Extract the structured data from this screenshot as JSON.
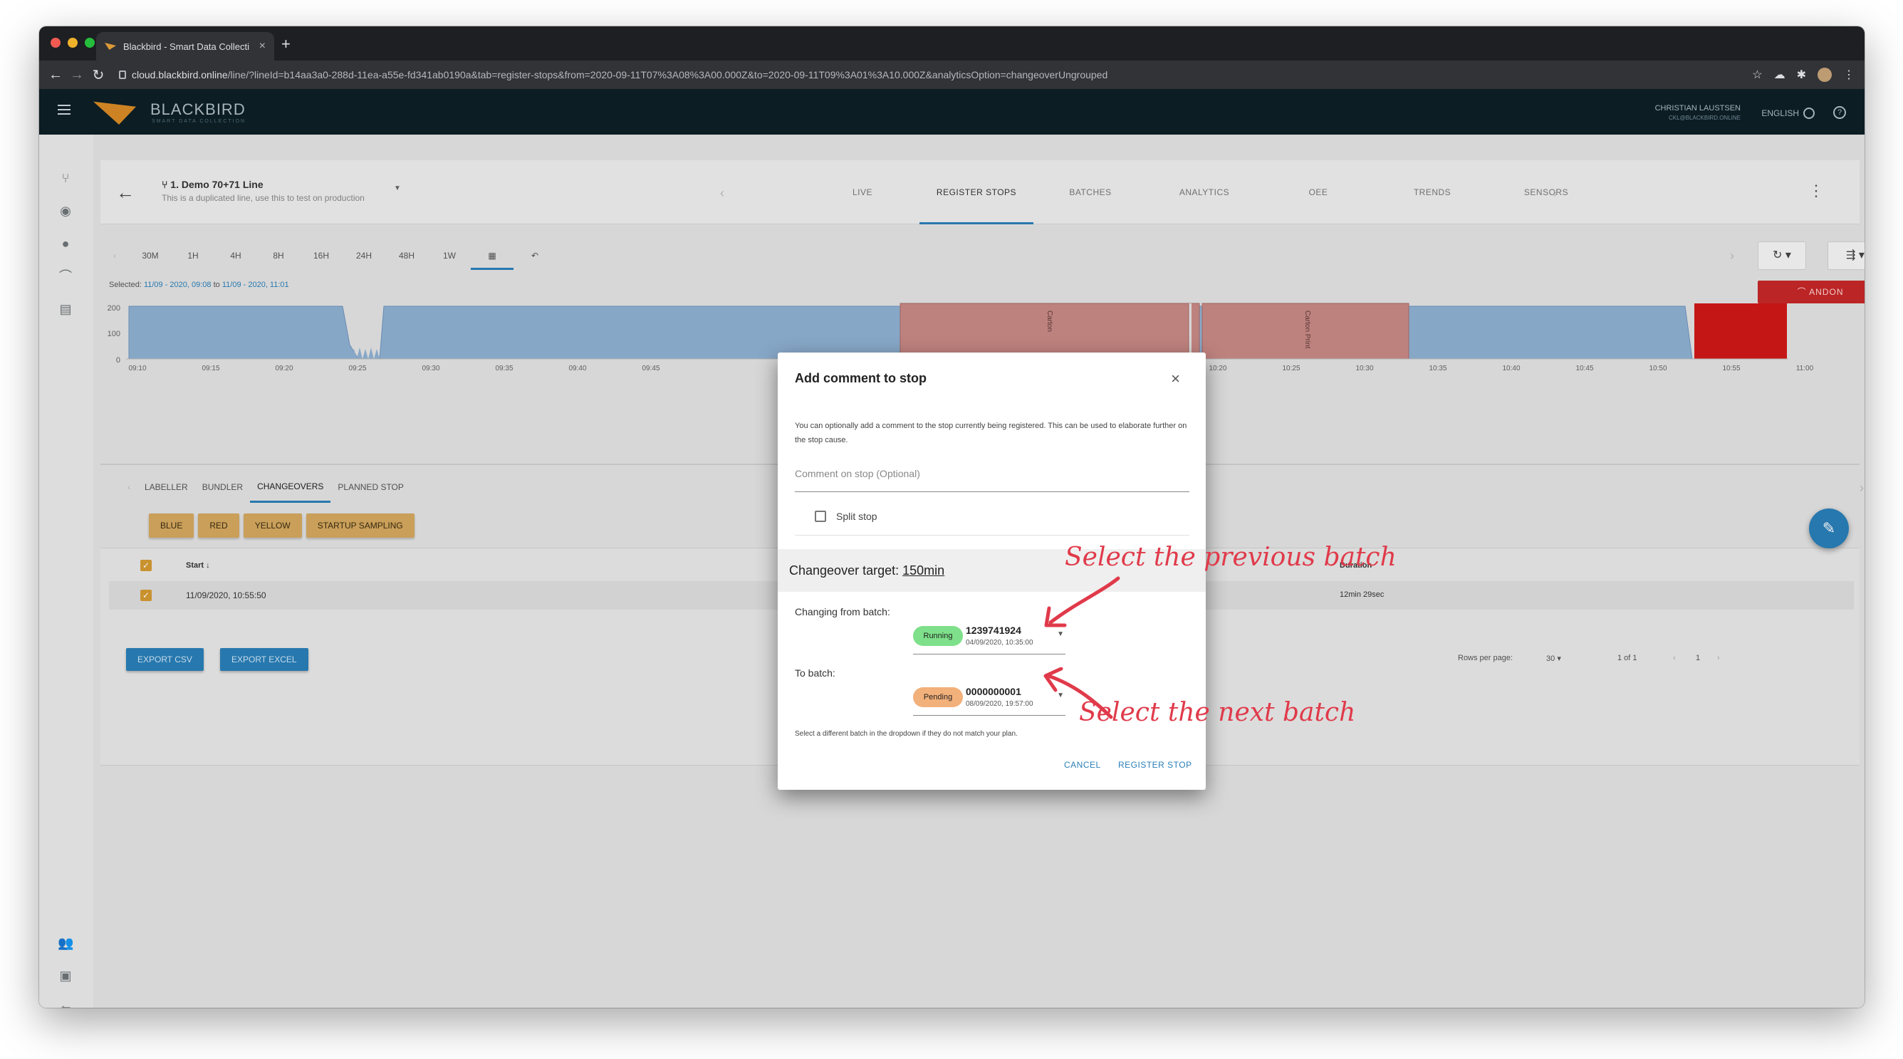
{
  "browser": {
    "tab_title": "Blackbird - Smart Data Collecti",
    "url_host": "cloud.blackbird.online",
    "url_path": "/line/?lineId=b14aa3a0-288d-11ea-a55e-fd341ab0190a&tab=register-stops&from=2020-09-11T07%3A08%3A00.000Z&to=2020-09-11T09%3A01%3A10.000Z&analyticsOption=changeoverUngrouped"
  },
  "app": {
    "brand": "BLACKBIRD",
    "brand_sub": "SMART DATA COLLECTION",
    "user_name": "CHRISTIAN LAUSTSEN",
    "user_email": "CKL@BLACKBIRD.ONLINE",
    "language": "ENGLISH"
  },
  "line": {
    "name": "1. Demo 70+71 Line",
    "description": "This is a duplicated line, use this to test on production",
    "tabs": [
      {
        "label": "LIVE"
      },
      {
        "label": "REGISTER STOPS"
      },
      {
        "label": "BATCHES"
      },
      {
        "label": "ANALYTICS"
      },
      {
        "label": "OEE"
      },
      {
        "label": "TRENDS"
      },
      {
        "label": "SENSORS"
      }
    ]
  },
  "timerange": {
    "buttons": [
      "30M",
      "1H",
      "4H",
      "8H",
      "16H",
      "24H",
      "48H",
      "1W"
    ],
    "selected_label": "Selected:",
    "from": "11/09 - 2020, 09:08",
    "to_word": "to",
    "to": "11/09 - 2020, 11:01",
    "andon_label": "ANDON"
  },
  "chart_data": {
    "type": "area",
    "y_ticks": [
      "200",
      "100",
      "0"
    ],
    "x_ticks": [
      "09:10",
      "09:15",
      "09:20",
      "09:25",
      "09:30",
      "09:35",
      "09:40",
      "09:45",
      "10:20",
      "10:25",
      "10:30",
      "10:35",
      "10:40",
      "10:45",
      "10:50",
      "10:55",
      "11:00"
    ],
    "stop_labels": [
      "Carton",
      "Carton Print"
    ]
  },
  "subtabs": [
    {
      "label": "LABELLER"
    },
    {
      "label": "BUNDLER"
    },
    {
      "label": "CHANGEOVERS"
    },
    {
      "label": "PLANNED STOP"
    }
  ],
  "chips": [
    {
      "label": "BLUE"
    },
    {
      "label": "RED"
    },
    {
      "label": "YELLOW"
    },
    {
      "label": "STARTUP SAMPLING"
    }
  ],
  "table": {
    "col_start": "Start",
    "col_duration": "Duration",
    "row_start": "11/09/2020, 10:55:50",
    "row_duration": "12min 29sec",
    "export_csv": "EXPORT CSV",
    "export_excel": "EXPORT EXCEL",
    "rows_per_page_label": "Rows per page:",
    "rows_per_page": "30",
    "page_range": "1 of 1",
    "page_num": "1"
  },
  "dialog": {
    "title": "Add comment to stop",
    "description": "You can optionally add a comment to the stop currently being registered. This can be used to elaborate further on the stop cause.",
    "comment_placeholder": "Comment on stop (Optional)",
    "split_label": "Split stop",
    "changeover_label": "Changeover target:",
    "changeover_value": "150min",
    "from_label": "Changing from batch:",
    "from_status": "Running",
    "from_batch": "1239741924",
    "from_date": "04/09/2020, 10:35:00",
    "to_label": "To batch:",
    "to_status": "Pending",
    "to_batch": "0000000001",
    "to_date": "08/09/2020, 19:57:00",
    "note": "Select a different batch in the dropdown if they do not match your plan.",
    "cancel": "CANCEL",
    "register": "REGISTER STOP"
  },
  "annotations": {
    "previous": "Select the previous batch",
    "next": "Select the next batch"
  },
  "colors": {
    "running": "#7ee08a",
    "pending": "#f2b07a",
    "accent": "#2a7fb8",
    "andon": "#c62828"
  }
}
